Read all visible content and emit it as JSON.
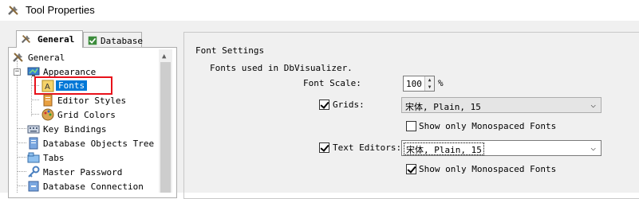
{
  "window": {
    "title": "Tool Properties",
    "icon": "tools-icon"
  },
  "tabs": [
    {
      "label": "General",
      "icon": "tools-icon",
      "active": true
    },
    {
      "label": "Database",
      "icon": "database-icon",
      "active": false
    }
  ],
  "tree": {
    "root": "General",
    "appearance": "Appearance",
    "fonts": "Fonts",
    "editor_styles": "Editor Styles",
    "grid_colors": "Grid Colors",
    "key_bindings": "Key Bindings",
    "database_objects_tree": "Database Objects Tree",
    "tabs": "Tabs",
    "master_password": "Master Password",
    "database_connection": "Database Connection"
  },
  "font_settings": {
    "section_title": "Font Settings",
    "hint": "Fonts used in DbVisualizer.",
    "font_scale_label": "Font Scale:",
    "font_scale_value": "100",
    "font_scale_unit": "%",
    "grids_label": "Grids:",
    "grids_checked": true,
    "grids_font": "宋体, Plain, 15",
    "grids_mono_label": "Show only Monospaced Fonts",
    "grids_mono_checked": false,
    "editors_label": "Text Editors:",
    "editors_checked": true,
    "editors_font": "宋体, Plain, 15",
    "editors_mono_label": "Show only Monospaced Fonts",
    "editors_mono_checked": true
  },
  "colors": {
    "selection": "#0078d7",
    "annotation_box": "#e8111a"
  }
}
